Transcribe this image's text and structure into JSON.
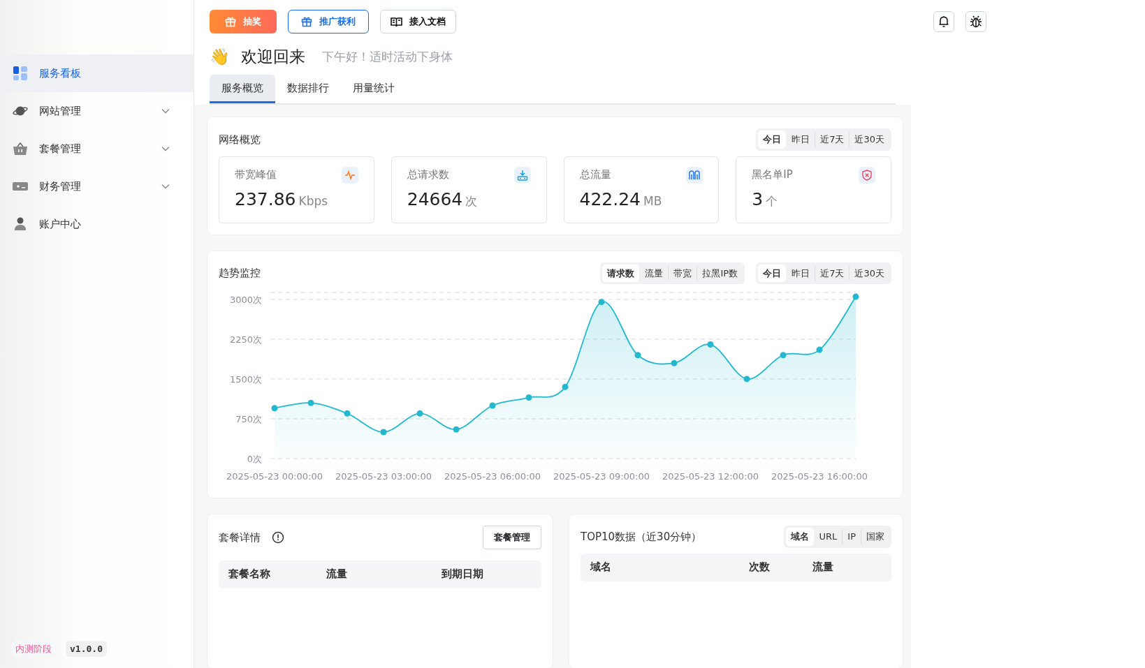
{
  "sidebar": {
    "items": [
      {
        "label": "服务看板",
        "selected": true,
        "expandable": false
      },
      {
        "label": "网站管理",
        "selected": false,
        "expandable": true
      },
      {
        "label": "套餐管理",
        "selected": false,
        "expandable": true
      },
      {
        "label": "财务管理",
        "selected": false,
        "expandable": true
      },
      {
        "label": "账户中心",
        "selected": false,
        "expandable": false
      }
    ],
    "footer": {
      "stage": "内测阶段",
      "version": "v1.0.0"
    }
  },
  "top_buttons": [
    {
      "label": "抽奖",
      "kind": "primary"
    },
    {
      "label": "推广获利",
      "kind": "outline"
    },
    {
      "label": "接入文档",
      "kind": "plain"
    }
  ],
  "greeting": {
    "emoji": "👋",
    "title": "欢迎回来",
    "subtitle": "下午好！适时活动下身体"
  },
  "tabs": [
    {
      "label": "服务概览",
      "selected": true
    },
    {
      "label": "数据排行",
      "selected": false
    },
    {
      "label": "用量统计",
      "selected": false
    }
  ],
  "network_overview": {
    "title": "网络概览",
    "periods": [
      {
        "label": "今日",
        "selected": true
      },
      {
        "label": "昨日",
        "selected": false
      },
      {
        "label": "近7天",
        "selected": false
      },
      {
        "label": "近30天",
        "selected": false
      }
    ],
    "stats": [
      {
        "label": "带宽峰值",
        "value": "237.86",
        "unit": "Kbps"
      },
      {
        "label": "总请求数",
        "value": "24664",
        "unit": "次"
      },
      {
        "label": "总流量",
        "value": "422.24",
        "unit": "MB"
      },
      {
        "label": "黑名单IP",
        "value": "3",
        "unit": "个"
      }
    ]
  },
  "trend": {
    "title": "趋势监控",
    "metrics": [
      {
        "label": "请求数",
        "selected": true
      },
      {
        "label": "流量",
        "selected": false
      },
      {
        "label": "带宽",
        "selected": false
      },
      {
        "label": "拉黑IP数",
        "selected": false
      }
    ],
    "periods": [
      {
        "label": "今日",
        "selected": true
      },
      {
        "label": "昨日",
        "selected": false
      },
      {
        "label": "近7天",
        "selected": false
      },
      {
        "label": "近30天",
        "selected": false
      }
    ],
    "chart_data": {
      "type": "area",
      "categories": [
        "2025-05-23 00:00:00",
        null,
        null,
        "2025-05-23 03:00:00",
        null,
        null,
        "2025-05-23 06:00:00",
        null,
        null,
        "2025-05-23 09:00:00",
        null,
        null,
        "2025-05-23 12:00:00",
        null,
        null,
        "2025-05-23 16:00:00",
        null
      ],
      "series": [
        {
          "color": "#22b8cf",
          "values": [
            950,
            1050,
            850,
            500,
            850,
            550,
            1000,
            1150,
            1350,
            2950,
            1950,
            1800,
            2150,
            1500,
            1950,
            2050,
            3050
          ]
        }
      ],
      "grid": true,
      "ylim": [
        0,
        3130
      ],
      "yticks": [
        {
          "value": 0,
          "label": "0次"
        },
        {
          "value": 750,
          "label": "750次"
        },
        {
          "value": 1500,
          "label": "1500次"
        },
        {
          "value": 2250,
          "label": "2250次"
        },
        {
          "value": 3000,
          "label": "3000次"
        }
      ]
    }
  },
  "package": {
    "title": "套餐详情",
    "button": "套餐管理",
    "columns": [
      "套餐名称",
      "流量",
      "到期日期"
    ]
  },
  "top10": {
    "title": "TOP10数据（近30分钟）",
    "filters": [
      {
        "label": "域名",
        "selected": true
      },
      {
        "label": "URL",
        "selected": false
      },
      {
        "label": "IP",
        "selected": false
      },
      {
        "label": "国家",
        "selected": false
      }
    ],
    "columns": [
      "域名",
      "次数",
      "流量"
    ]
  }
}
